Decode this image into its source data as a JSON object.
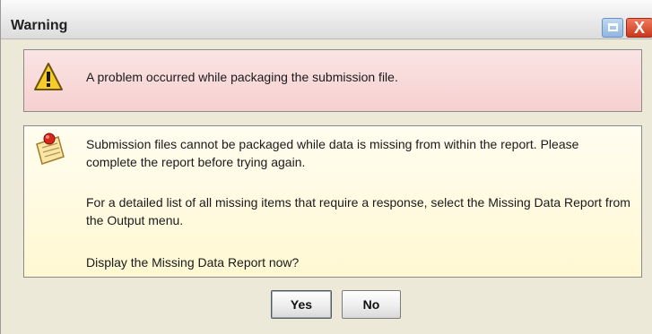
{
  "window": {
    "title": "Warning",
    "restore_icon": "restore-icon",
    "close_icon": "close-icon",
    "close_glyph": "X"
  },
  "warning_panel": {
    "icon": "warning-icon",
    "message": "A problem occurred while packaging the submission file."
  },
  "info_panel": {
    "icon": "note-icon",
    "paragraphs": [
      "Submission files cannot be packaged while data is missing from within the report.  Please complete the report before trying again.",
      "For a detailed list of all missing items that require a response, select the Missing Data Report from the Output menu.",
      "Display the Missing Data Report now?"
    ]
  },
  "buttons": {
    "yes_label": "Yes",
    "no_label": "No"
  },
  "colors": {
    "warning_bg": "#f6d0d0",
    "info_bg": "#fff8d2",
    "close_red": "#c9381d",
    "restore_blue": "#8fb6e2"
  }
}
